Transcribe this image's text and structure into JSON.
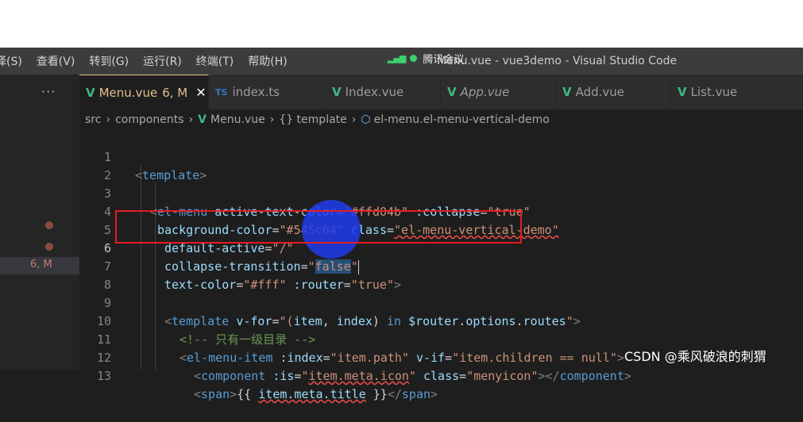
{
  "menu": [
    "择(S)",
    "查看(V)",
    "转到(G)",
    "运行(R)",
    "终端(T)",
    "帮助(H)"
  ],
  "meeting_label": "腾讯会议",
  "window_title": "Menu.vue - vue3demo - Visual Studio Code",
  "tabs": [
    {
      "label": "Menu.vue",
      "suffix": "6, M",
      "kind": "vue",
      "active": true
    },
    {
      "label": "index.ts",
      "kind": "ts"
    },
    {
      "label": "Index.vue",
      "kind": "vue"
    },
    {
      "label": "App.vue",
      "kind": "vue",
      "italic": true
    },
    {
      "label": "Add.vue",
      "kind": "vue"
    },
    {
      "label": "List.vue",
      "kind": "vue"
    }
  ],
  "sidebar": {
    "more": "···",
    "badge": "6, M"
  },
  "breadcrumb": {
    "p1": "src",
    "p2": "components",
    "p3": "Menu.vue",
    "p4": "{} template",
    "p5": "el-menu.el-menu-vertical-demo"
  },
  "line_numbers": [
    "1",
    "2",
    "3",
    "4",
    "5",
    "6",
    "7",
    "8",
    "9",
    "10",
    "11",
    "12",
    "13"
  ],
  "code": {
    "l1": {
      "tag": "template"
    },
    "l3": {
      "tag": "el-menu",
      "a1": "active-text-color",
      "v1": "\"#ffd04b\"",
      "a2": ":collapse",
      "v2": "\"true\""
    },
    "l4": {
      "a1": "background-color",
      "v1": "\"#545c64\"",
      "a2": "class",
      "v2": "\"el-menu-vertical-demo\""
    },
    "l5": {
      "a1": "default-active",
      "v1": "\"/\""
    },
    "l6": {
      "a1": "collapse-transition",
      "v1a": "\"",
      "v1b": "false",
      "v1c": "\""
    },
    "l7": {
      "a1": "text-color",
      "v1": "\"#fff\"",
      "a2": ":router",
      "v2": "\"true\""
    },
    "l9": {
      "tag": "template",
      "a1": "v-for",
      "q": "\"(",
      "var1": "item",
      "comma": ", ",
      "var2": "index",
      "close": ")",
      "kwin": " in ",
      "var3": "$router",
      "dot1": ".",
      "var4": "options",
      "dot2": ".",
      "var5": "routes",
      "qend": "\""
    },
    "l10": {
      "comment": "<!-- 只有一级目录 -->"
    },
    "l11": {
      "tag": "el-menu-item",
      "a1": ":index",
      "v1": "\"item.path\"",
      "a2": "v-if",
      "v2": "\"item.children == null\""
    },
    "l12": {
      "tag": "component",
      "a1": ":is",
      "v1q": "\"",
      "v1": "item.meta.icon",
      "v1e": "\"",
      "a2": "class",
      "v2": "\"menyicon\"",
      "endtag": "component"
    },
    "l13": {
      "tag": "span",
      "mo": "{{ ",
      "expr": "item.meta.title",
      "mc": " }}",
      "endtag": "span"
    }
  },
  "watermark": "CSDN @乘风破浪的刺猬"
}
